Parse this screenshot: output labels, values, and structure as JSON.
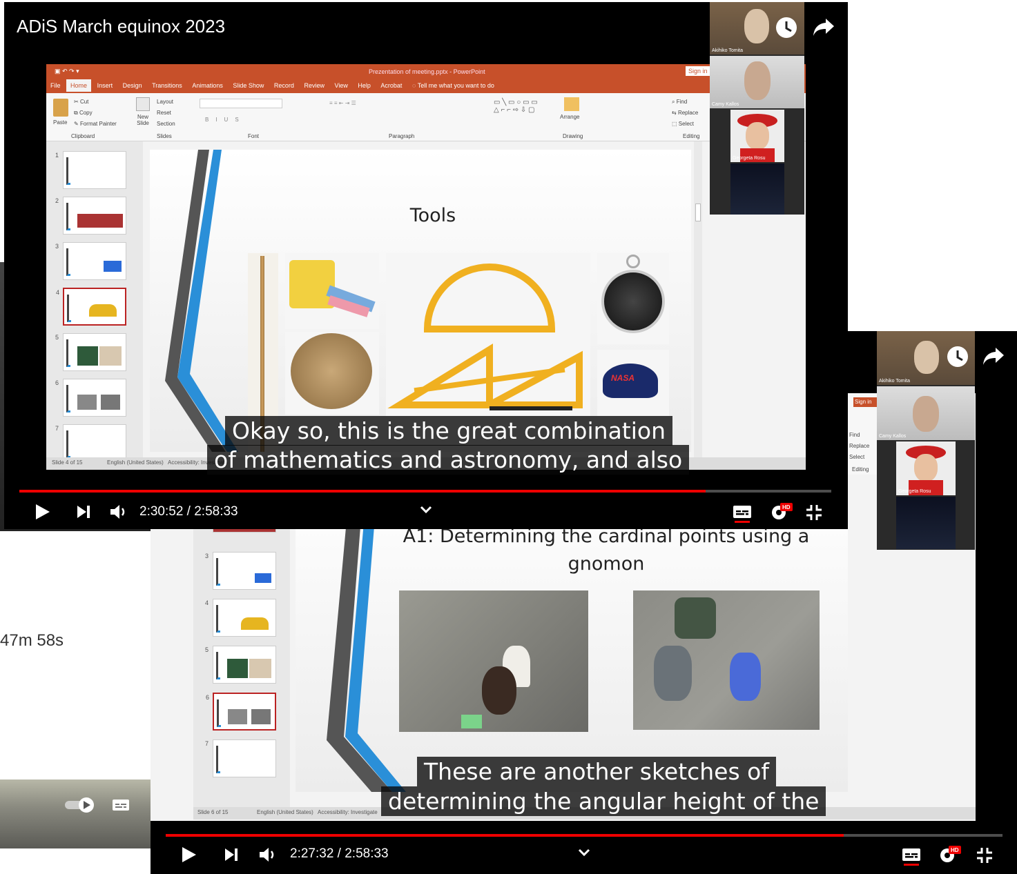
{
  "background_window": {
    "duration_label": "47m 58s"
  },
  "player_front": {
    "title": "ADiS March equinox 2023",
    "powerpoint": {
      "window_title": "Prezentation of meeting.pptx - PowerPoint",
      "sign_in": "Sign in",
      "tabs": [
        "File",
        "Home",
        "Insert",
        "Design",
        "Transitions",
        "Animations",
        "Slide Show",
        "Record",
        "Review",
        "View",
        "Help",
        "Acrobat"
      ],
      "tell_me": "Tell me what you want to do",
      "ribbon": {
        "paste": "Paste",
        "cut": "Cut",
        "copy": "Copy",
        "format_painter": "Format Painter",
        "clipboard": "Clipboard",
        "new_slide": "New Slide",
        "layout": "Layout",
        "reset": "Reset",
        "section": "Section",
        "slides": "Slides",
        "font": "Font",
        "paragraph": "Paragraph",
        "arrange": "Arrange",
        "drawing": "Drawing",
        "find": "Find",
        "replace": "Replace",
        "select": "Select",
        "editing": "Editing"
      },
      "slide_title": "Tools",
      "status_left": "Slide 4 of 15",
      "status_lang": "English (United States)",
      "status_access": "Accessibility: Investigate"
    },
    "participants": [
      {
        "name": "Akihiko Tomita"
      },
      {
        "name": "Camy Kallos"
      },
      {
        "name": "Georgeta Rosu"
      },
      {
        "name": ""
      }
    ],
    "caption_lines": [
      "Okay so, this is the great combination",
      "of mathematics and astronomy, and also"
    ],
    "time": "2:30:52 / 2:58:33",
    "progress_fraction": 0.845
  },
  "player_back": {
    "powerpoint": {
      "find": "Find",
      "replace": "Replace",
      "select": "Select",
      "editing": "Editing",
      "sign_in": "Sign in",
      "slide_title_line1": "A1: Determining the cardinal points using a",
      "slide_title_line2": "gnomon",
      "status_left": "Slide 6 of 15",
      "status_lang": "English (United States)",
      "status_access": "Accessibility: Investigate"
    },
    "participants": [
      {
        "name": "Akihiko Tomita"
      },
      {
        "name": "Camy Kallos"
      },
      {
        "name": "Georgeta Rosu"
      },
      {
        "name": ""
      }
    ],
    "caption_lines": [
      "These are another sketches of",
      "determining the angular height of the"
    ],
    "time": "2:27:32 / 2:58:33",
    "progress_fraction": 0.81
  },
  "colors": {
    "ppt_accent": "#c7502a",
    "progress_red": "#ff0000",
    "slide_blue": "#2a8fd8"
  },
  "icons": [
    "clock-icon",
    "share-icon",
    "play-icon",
    "next-icon",
    "volume-icon",
    "chevron-down-icon",
    "subtitles-icon",
    "settings-hd-icon",
    "exit-fullscreen-icon",
    "autoplay-toggle-icon"
  ]
}
